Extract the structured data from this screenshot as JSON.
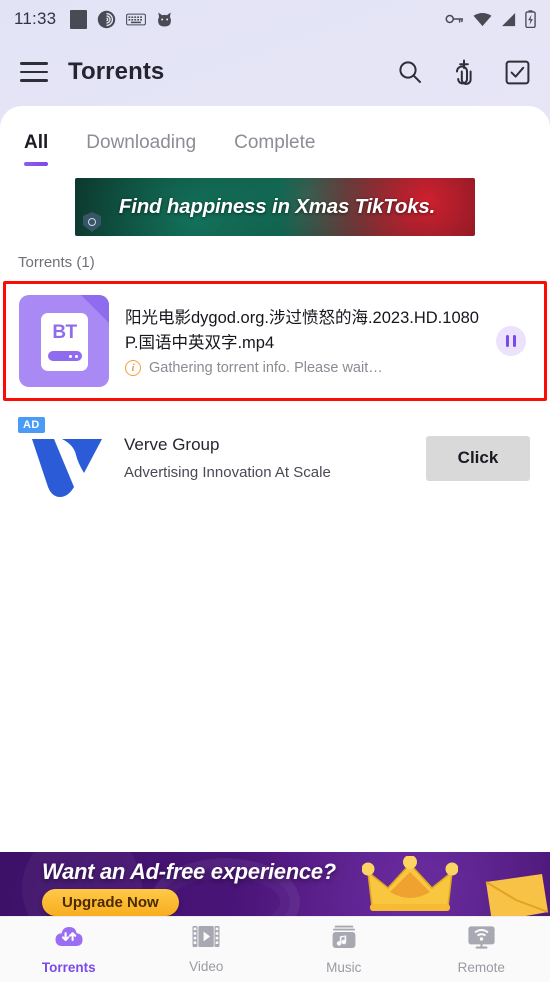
{
  "statusbar": {
    "time": "11:33",
    "left_icons": [
      "square-icon",
      "bittorrent-icon",
      "keyboard-icon",
      "cat-icon"
    ],
    "right_icons": [
      "vpn-key-icon",
      "wifi-icon",
      "cellular-signal-icon",
      "battery-charging-icon"
    ]
  },
  "appbar": {
    "menu_icon": "hamburger-menu-icon",
    "title": "Torrents",
    "actions": [
      {
        "name": "search-icon",
        "label": "Search"
      },
      {
        "name": "add-magnet-icon",
        "label": "Add torrent"
      },
      {
        "name": "select-all-icon",
        "label": "Select"
      }
    ]
  },
  "tabs": [
    {
      "label": "All",
      "active": true
    },
    {
      "label": "Downloading",
      "active": false
    },
    {
      "label": "Complete",
      "active": false
    }
  ],
  "banner_ad": {
    "text": "Find happiness in Xmas TikToks.",
    "privacy_icon": "ad-privacy-shield-icon"
  },
  "torrents": {
    "section_label": "Torrents (1)",
    "highlight_color": "#fb0d05",
    "items": [
      {
        "icon_label": "BT",
        "name": "阳光电影dygod.org.涉过愤怒的海.2023.HD.1080P.国语中英双字.mp4",
        "status": "Gathering torrent info. Please wait…",
        "status_icon": "info-icon",
        "action_icon": "pause-icon"
      }
    ]
  },
  "native_ad": {
    "badge": "AD",
    "logo": "verve-v-logo",
    "title": "Verve Group",
    "subtitle": "Advertising Innovation At Scale",
    "cta_label": "Click"
  },
  "upgrade_banner": {
    "title": "Want an Ad-free experience?",
    "button_label": "Upgrade Now",
    "crown_icon": "gold-crown-icon",
    "envelope_icon": "gold-envelope-icon"
  },
  "bottom_nav": [
    {
      "label": "Torrents",
      "icon": "cloud-transfer-icon",
      "active": true
    },
    {
      "label": "Video",
      "icon": "film-strip-icon",
      "active": false
    },
    {
      "label": "Music",
      "icon": "music-note-icon",
      "active": false
    },
    {
      "label": "Remote",
      "icon": "remote-monitor-wifi-icon",
      "active": false
    }
  ],
  "colors": {
    "accent": "#7b4ae8",
    "accent_light": "#a98af5",
    "highlight": "#fb0d05",
    "ad_badge": "#4a9bf5",
    "info": "#f5a23a"
  }
}
